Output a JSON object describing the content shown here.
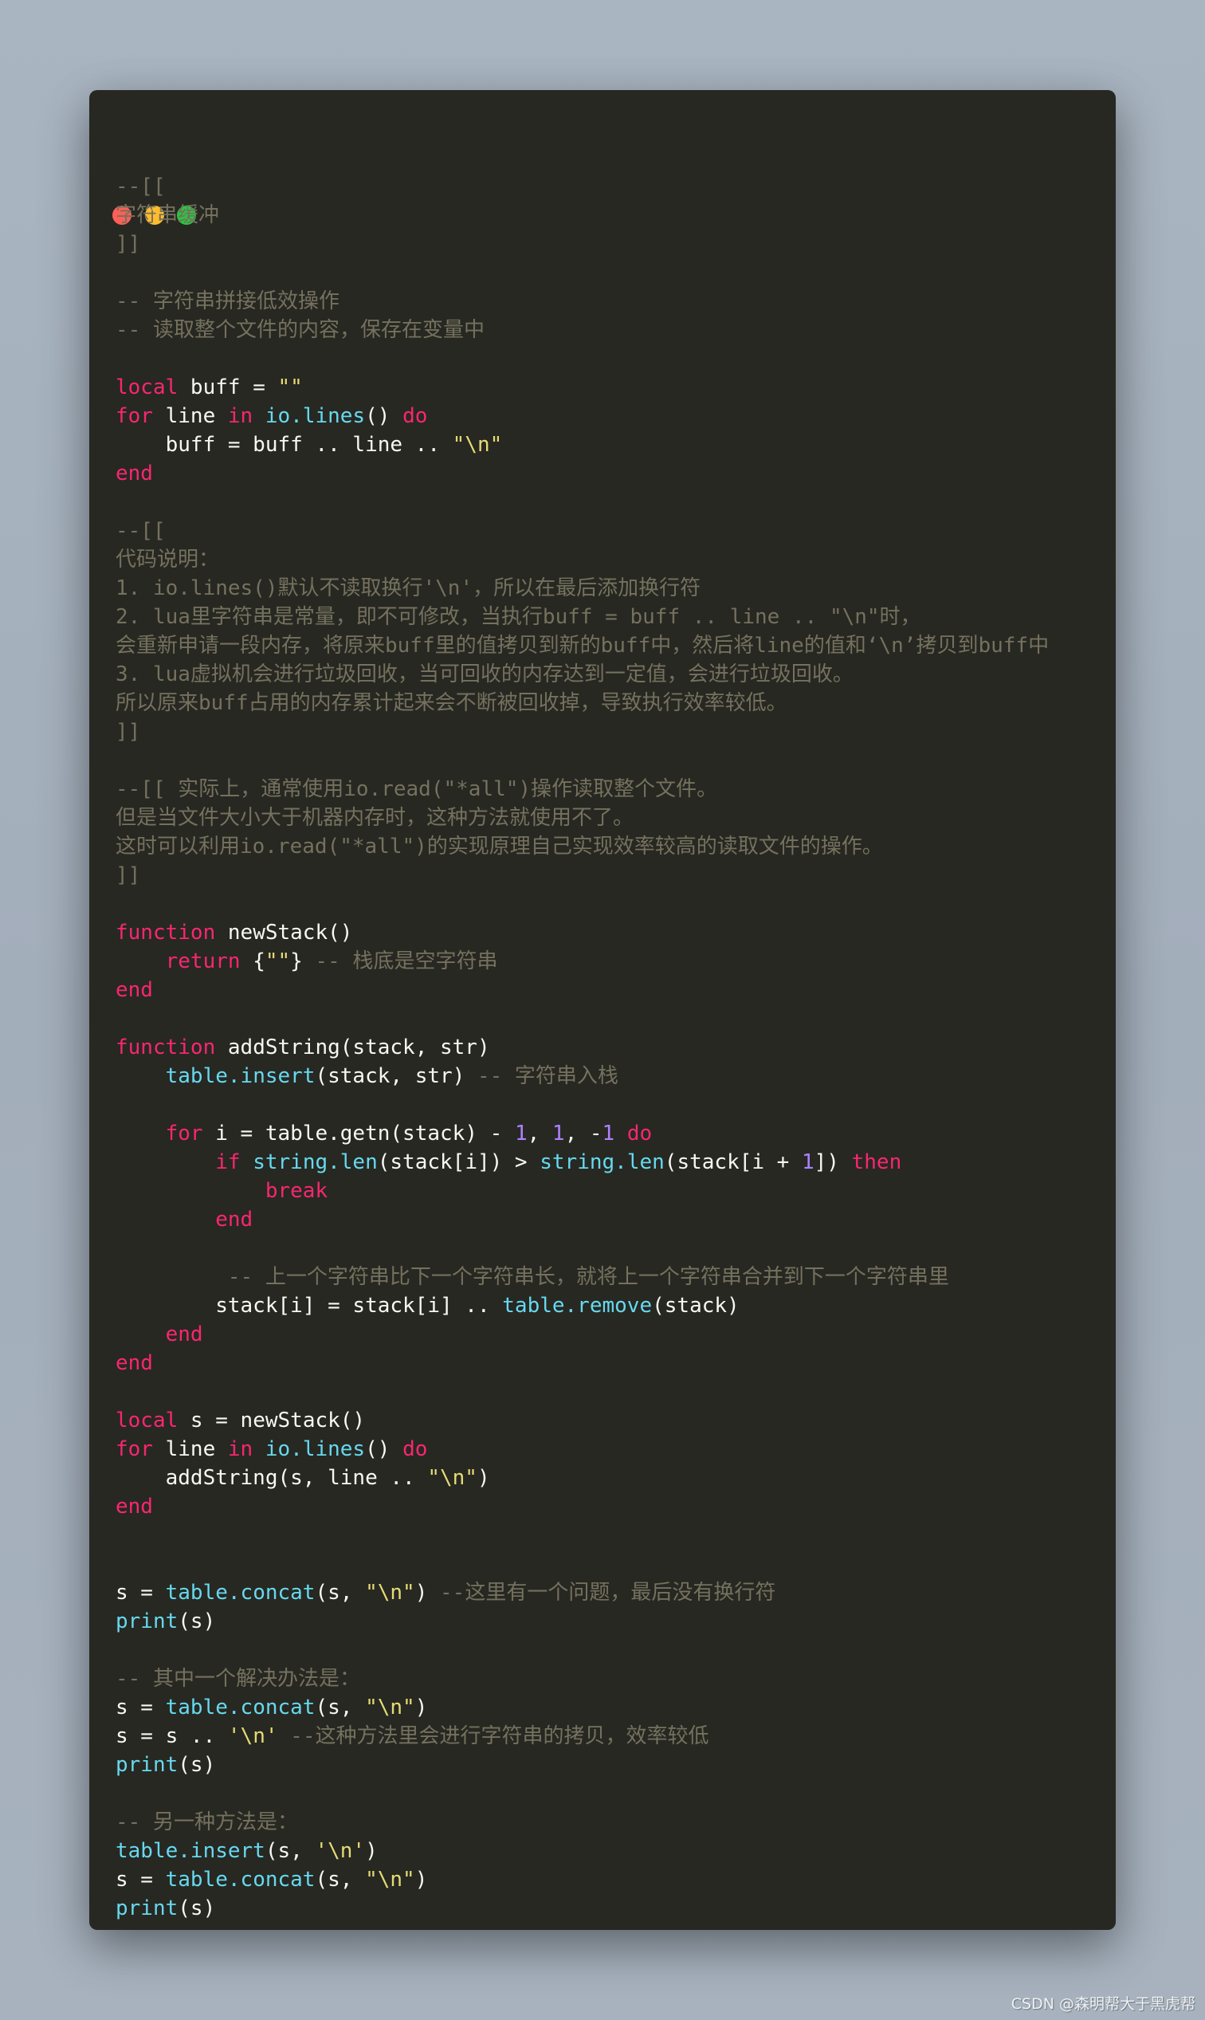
{
  "window": {
    "controls": [
      {
        "name": "close",
        "color": "#ff5f56"
      },
      {
        "name": "minimize",
        "color": "#ffbd2e"
      },
      {
        "name": "maximize",
        "color": "#27c93f"
      }
    ],
    "background": "#272822"
  },
  "syntax_colors": {
    "keyword": "#f92672",
    "builtin": "#66d9ef",
    "string": "#e6db74",
    "number": "#ae81ff",
    "comment": "#75715e",
    "plain": "#f8f8f2"
  },
  "code_lines": [
    [
      [
        "c",
        "--[["
      ]
    ],
    [
      [
        "c",
        "字符串缓冲"
      ]
    ],
    [
      [
        "c",
        "]]"
      ]
    ],
    [],
    [
      [
        "c",
        "-- 字符串拼接低效操作"
      ]
    ],
    [
      [
        "c",
        "-- 读取整个文件的内容，保存在变量中"
      ]
    ],
    [],
    [
      [
        "k",
        "local"
      ],
      [
        "p",
        " buff = "
      ],
      [
        "s",
        "\"\""
      ]
    ],
    [
      [
        "k",
        "for"
      ],
      [
        "p",
        " line "
      ],
      [
        "k",
        "in"
      ],
      [
        "p",
        " "
      ],
      [
        "b",
        "io.lines"
      ],
      [
        "p",
        "() "
      ],
      [
        "k",
        "do"
      ]
    ],
    [
      [
        "p",
        "    buff = buff .. line .. "
      ],
      [
        "s",
        "\"\\n\""
      ]
    ],
    [
      [
        "k",
        "end"
      ]
    ],
    [],
    [
      [
        "c",
        "--[["
      ]
    ],
    [
      [
        "c",
        "代码说明："
      ]
    ],
    [
      [
        "c",
        "1. io.lines()默认不读取换行'\\n'，所以在最后添加换行符"
      ]
    ],
    [
      [
        "c",
        "2. lua里字符串是常量，即不可修改，当执行buff = buff .. line .. \"\\n\"时，"
      ]
    ],
    [
      [
        "c",
        "会重新申请一段内存，将原来buff里的值拷贝到新的buff中，然后将line的值和‘\\n’拷贝到buff中"
      ]
    ],
    [
      [
        "c",
        "3. lua虚拟机会进行垃圾回收，当可回收的内存达到一定值，会进行垃圾回收。"
      ]
    ],
    [
      [
        "c",
        "所以原来buff占用的内存累计起来会不断被回收掉，导致执行效率较低。"
      ]
    ],
    [
      [
        "c",
        "]]"
      ]
    ],
    [],
    [
      [
        "c",
        "--[[ 实际上，通常使用io.read(\"*all\")操作读取整个文件。"
      ]
    ],
    [
      [
        "c",
        "但是当文件大小大于机器内存时，这种方法就使用不了。"
      ]
    ],
    [
      [
        "c",
        "这时可以利用io.read(\"*all\")的实现原理自己实现效率较高的读取文件的操作。"
      ]
    ],
    [
      [
        "c",
        "]]"
      ]
    ],
    [],
    [
      [
        "k",
        "function"
      ],
      [
        "p",
        " newStack()"
      ]
    ],
    [
      [
        "p",
        "    "
      ],
      [
        "k",
        "return"
      ],
      [
        "p",
        " {"
      ],
      [
        "s",
        "\"\""
      ],
      [
        "p",
        "} "
      ],
      [
        "c",
        "-- 栈底是空字符串"
      ]
    ],
    [
      [
        "k",
        "end"
      ]
    ],
    [],
    [
      [
        "k",
        "function"
      ],
      [
        "p",
        " addString(stack, str)"
      ]
    ],
    [
      [
        "p",
        "    "
      ],
      [
        "b",
        "table.insert"
      ],
      [
        "p",
        "(stack, str) "
      ],
      [
        "c",
        "-- 字符串入栈"
      ]
    ],
    [],
    [
      [
        "p",
        "    "
      ],
      [
        "k",
        "for"
      ],
      [
        "p",
        " i = table.getn(stack) - "
      ],
      [
        "n",
        "1"
      ],
      [
        "p",
        ", "
      ],
      [
        "n",
        "1"
      ],
      [
        "p",
        ", -"
      ],
      [
        "n",
        "1"
      ],
      [
        "p",
        " "
      ],
      [
        "k",
        "do"
      ]
    ],
    [
      [
        "p",
        "        "
      ],
      [
        "k",
        "if"
      ],
      [
        "p",
        " "
      ],
      [
        "b",
        "string.len"
      ],
      [
        "p",
        "(stack[i]) > "
      ],
      [
        "b",
        "string.len"
      ],
      [
        "p",
        "(stack[i + "
      ],
      [
        "n",
        "1"
      ],
      [
        "p",
        "]) "
      ],
      [
        "k",
        "then"
      ]
    ],
    [
      [
        "p",
        "            "
      ],
      [
        "k",
        "break"
      ]
    ],
    [
      [
        "p",
        "        "
      ],
      [
        "k",
        "end"
      ]
    ],
    [],
    [
      [
        "p",
        "         "
      ],
      [
        "c",
        "-- 上一个字符串比下一个字符串长，就将上一个字符串合并到下一个字符串里"
      ]
    ],
    [
      [
        "p",
        "        stack[i] = stack[i] .. "
      ],
      [
        "b",
        "table.remove"
      ],
      [
        "p",
        "(stack)"
      ]
    ],
    [
      [
        "p",
        "    "
      ],
      [
        "k",
        "end"
      ]
    ],
    [
      [
        "k",
        "end"
      ]
    ],
    [],
    [
      [
        "k",
        "local"
      ],
      [
        "p",
        " s = newStack()"
      ]
    ],
    [
      [
        "k",
        "for"
      ],
      [
        "p",
        " line "
      ],
      [
        "k",
        "in"
      ],
      [
        "p",
        " "
      ],
      [
        "b",
        "io.lines"
      ],
      [
        "p",
        "() "
      ],
      [
        "k",
        "do"
      ]
    ],
    [
      [
        "p",
        "    addString(s, line .. "
      ],
      [
        "s",
        "\"\\n\""
      ],
      [
        "p",
        ")"
      ]
    ],
    [
      [
        "k",
        "end"
      ]
    ],
    [],
    [],
    [
      [
        "p",
        "s = "
      ],
      [
        "b",
        "table.concat"
      ],
      [
        "p",
        "(s, "
      ],
      [
        "s",
        "\"\\n\""
      ],
      [
        "p",
        ") "
      ],
      [
        "c",
        "--这里有一个问题，最后没有换行符"
      ]
    ],
    [
      [
        "b",
        "print"
      ],
      [
        "p",
        "(s)"
      ]
    ],
    [],
    [
      [
        "c",
        "-- 其中一个解决办法是："
      ]
    ],
    [
      [
        "p",
        "s = "
      ],
      [
        "b",
        "table.concat"
      ],
      [
        "p",
        "(s, "
      ],
      [
        "s",
        "\"\\n\""
      ],
      [
        "p",
        ")"
      ]
    ],
    [
      [
        "p",
        "s = s .. "
      ],
      [
        "s",
        "'\\n'"
      ],
      [
        "p",
        " "
      ],
      [
        "c",
        "--这种方法里会进行字符串的拷贝，效率较低"
      ]
    ],
    [
      [
        "b",
        "print"
      ],
      [
        "p",
        "(s)"
      ]
    ],
    [],
    [
      [
        "c",
        "-- 另一种方法是："
      ]
    ],
    [
      [
        "b",
        "table.insert"
      ],
      [
        "p",
        "(s, "
      ],
      [
        "s",
        "'\\n'"
      ],
      [
        "p",
        ")"
      ]
    ],
    [
      [
        "p",
        "s = "
      ],
      [
        "b",
        "table.concat"
      ],
      [
        "p",
        "(s, "
      ],
      [
        "s",
        "\"\\n\""
      ],
      [
        "p",
        ")"
      ]
    ],
    [
      [
        "b",
        "print"
      ],
      [
        "p",
        "(s)"
      ]
    ]
  ],
  "watermark": "CSDN @森明帮大于黑虎帮"
}
